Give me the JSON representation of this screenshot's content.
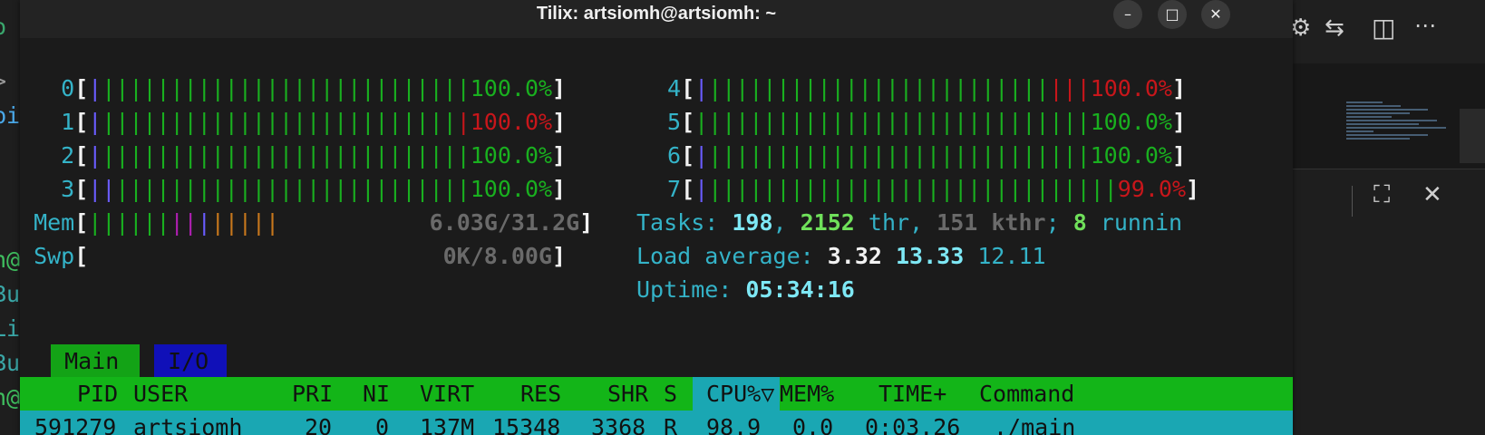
{
  "window": {
    "title": "Tilix: artsiomh@artsiomh: ~",
    "buttons": {
      "minimize": "–",
      "maximize": "□",
      "close": "✕"
    }
  },
  "cpus": [
    {
      "id": "0",
      "percent": "100.0%"
    },
    {
      "id": "1",
      "percent": "100.0%"
    },
    {
      "id": "2",
      "percent": "100.0%"
    },
    {
      "id": "3",
      "percent": "100.0%"
    },
    {
      "id": "4",
      "percent": "100.0%"
    },
    {
      "id": "5",
      "percent": "100.0%"
    },
    {
      "id": "6",
      "percent": "100.0%"
    },
    {
      "id": "7",
      "percent": "99.0%"
    }
  ],
  "memory": {
    "label": "Mem",
    "value": "6.03G/31.2G"
  },
  "swap": {
    "label": "Swp",
    "value": "0K/8.00G"
  },
  "tasks": {
    "label": "Tasks: ",
    "count": "198",
    "threads": "2152",
    "thr_label": " thr, ",
    "kthreads": "151 kthr",
    "sep": "; ",
    "running": "8",
    "running_label": " runnin"
  },
  "load": {
    "label": "Load average: ",
    "l1": "3.32",
    "l5": "13.33",
    "l15": "12.11"
  },
  "uptime": {
    "label": "Uptime: ",
    "value": "05:34:16"
  },
  "tabs": {
    "main": "Main",
    "io": "I/O"
  },
  "columns": {
    "pid": "PID",
    "user": "USER",
    "pri": "PRI",
    "ni": "NI",
    "virt": "VIRT",
    "res": "RES",
    "shr": "SHR",
    "s": "S",
    "cpu": "CPU%▽",
    "mem": "MEM%",
    "time": "TIME+",
    "command": "Command"
  },
  "process": {
    "pid": "591279",
    "user": "artsiomh",
    "pri": "20",
    "ni": "0",
    "virt": "137M",
    "res": "15348",
    "shr": "3368",
    "s": "R",
    "cpu": "98.9",
    "mem": "0.0",
    "time": "0:03.26",
    "command": "./main"
  },
  "background": {
    "left_fragments": [
      "o u",
      ">",
      "bi",
      "n@",
      "Bu",
      "Li",
      "Bu",
      "n@"
    ]
  },
  "colors": {
    "green_bar": "#19b01f",
    "cyan_label": "#34b3c8",
    "header_green": "#13b518",
    "highlight_cyan": "#1aa7b3"
  }
}
